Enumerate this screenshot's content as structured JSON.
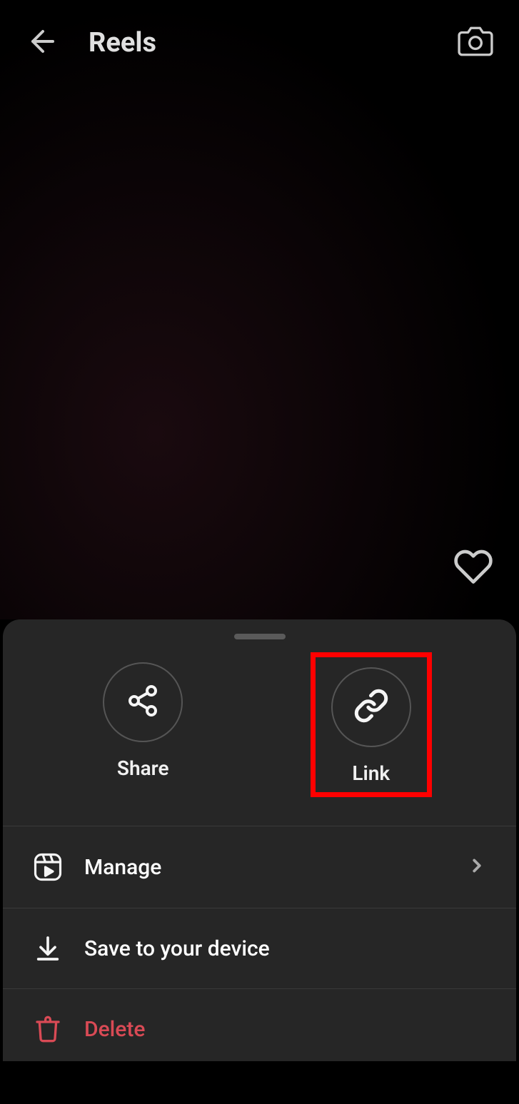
{
  "header": {
    "title": "Reels"
  },
  "sheet": {
    "share_action": "Share",
    "link_action": "Link",
    "items": {
      "manage": "Manage",
      "save": "Save to your device",
      "delete": "Delete"
    }
  },
  "colors": {
    "highlight": "#ff0000",
    "danger": "#d94a55",
    "sheet_bg": "#262626"
  }
}
